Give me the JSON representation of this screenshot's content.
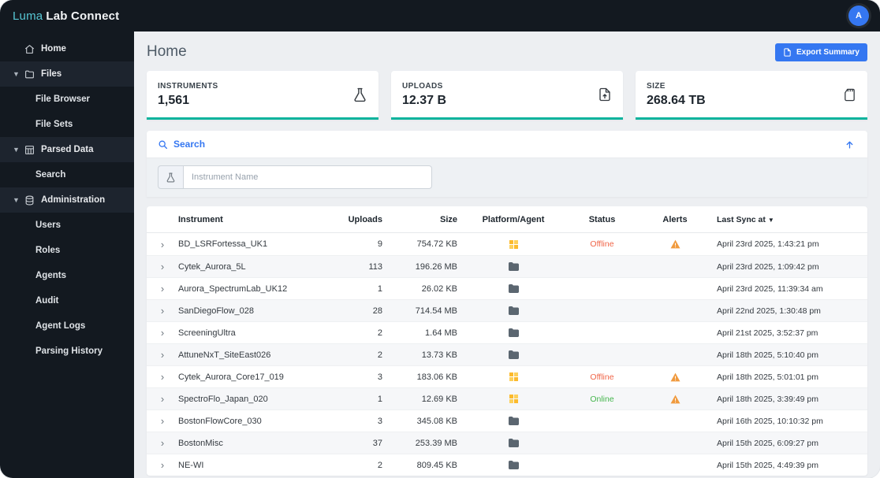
{
  "app": {
    "brand_luma": "Luma",
    "brand_rest": "Lab Connect",
    "avatar_initial": "A"
  },
  "sidebar": {
    "items": [
      {
        "label": "Home",
        "type": "link",
        "icon": "home-icon"
      },
      {
        "label": "Files",
        "type": "section",
        "icon": "folder-icon"
      },
      {
        "label": "File Browser",
        "type": "child"
      },
      {
        "label": "File Sets",
        "type": "child"
      },
      {
        "label": "Parsed Data",
        "type": "section",
        "icon": "table-icon"
      },
      {
        "label": "Search",
        "type": "child"
      },
      {
        "label": "Administration",
        "type": "section",
        "icon": "database-icon"
      },
      {
        "label": "Users",
        "type": "child"
      },
      {
        "label": "Roles",
        "type": "child"
      },
      {
        "label": "Agents",
        "type": "child"
      },
      {
        "label": "Audit",
        "type": "child"
      },
      {
        "label": "Agent Logs",
        "type": "child"
      },
      {
        "label": "Parsing History",
        "type": "child"
      }
    ]
  },
  "header": {
    "title": "Home",
    "export_button": "Export Summary"
  },
  "stats": [
    {
      "label": "INSTRUMENTS",
      "value": "1,561",
      "icon": "flask-icon"
    },
    {
      "label": "UPLOADS",
      "value": "12.37 B",
      "icon": "file-upload-icon"
    },
    {
      "label": "SIZE",
      "value": "268.64 TB",
      "icon": "storage-icon"
    }
  ],
  "search_panel": {
    "title": "Search",
    "input_placeholder": "Instrument Name"
  },
  "table": {
    "columns": [
      {
        "label": "Instrument"
      },
      {
        "label": "Uploads"
      },
      {
        "label": "Size"
      },
      {
        "label": "Platform/Agent"
      },
      {
        "label": "Status"
      },
      {
        "label": "Alerts"
      },
      {
        "label": "Last Sync at",
        "sort": "▼"
      }
    ],
    "rows": [
      {
        "instrument": "BD_LSRFortessa_UK1",
        "uploads": "9",
        "size": "754.72 KB",
        "platform": "grid",
        "status": "Offline",
        "alert": true,
        "last_sync": "April 23rd 2025, 1:43:21 pm"
      },
      {
        "instrument": "Cytek_Aurora_5L",
        "uploads": "113",
        "size": "196.26 MB",
        "platform": "folder",
        "status": "",
        "alert": false,
        "last_sync": "April 23rd 2025, 1:09:42 pm"
      },
      {
        "instrument": "Aurora_SpectrumLab_UK12",
        "uploads": "1",
        "size": "26.02 KB",
        "platform": "folder",
        "status": "",
        "alert": false,
        "last_sync": "April 23rd 2025, 11:39:34 am"
      },
      {
        "instrument": "SanDiegoFlow_028",
        "uploads": "28",
        "size": "714.54 MB",
        "platform": "folder",
        "status": "",
        "alert": false,
        "last_sync": "April 22nd 2025, 1:30:48 pm"
      },
      {
        "instrument": "ScreeningUltra",
        "uploads": "2",
        "size": "1.64 MB",
        "platform": "folder",
        "status": "",
        "alert": false,
        "last_sync": "April 21st 2025, 3:52:37 pm"
      },
      {
        "instrument": "AttuneNxT_SiteEast026",
        "uploads": "2",
        "size": "13.73 KB",
        "platform": "folder",
        "status": "",
        "alert": false,
        "last_sync": "April 18th 2025, 5:10:40 pm"
      },
      {
        "instrument": "Cytek_Aurora_Core17_019",
        "uploads": "3",
        "size": "183.06 KB",
        "platform": "grid",
        "status": "Offline",
        "alert": true,
        "last_sync": "April 18th 2025, 5:01:01 pm"
      },
      {
        "instrument": "SpectroFlo_Japan_020",
        "uploads": "1",
        "size": "12.69 KB",
        "platform": "grid",
        "status": "Online",
        "alert": true,
        "last_sync": "April 18th 2025, 3:39:49 pm"
      },
      {
        "instrument": "BostonFlowCore_030",
        "uploads": "3",
        "size": "345.08 KB",
        "platform": "folder",
        "status": "",
        "alert": false,
        "last_sync": "April 16th 2025, 10:10:32 pm"
      },
      {
        "instrument": "BostonMisc",
        "uploads": "37",
        "size": "253.39 MB",
        "platform": "folder",
        "status": "",
        "alert": false,
        "last_sync": "April 15th 2025, 6:09:27 pm"
      },
      {
        "instrument": "NE-WI",
        "uploads": "2",
        "size": "809.45 KB",
        "platform": "folder",
        "status": "",
        "alert": false,
        "last_sync": "April 15th 2025, 4:49:39 pm"
      }
    ]
  },
  "colors": {
    "accent_teal": "#0ab39c",
    "primary_blue": "#3577f1",
    "status_offline": "#f06548",
    "status_online": "#45b64d",
    "alert_warning": "#f09a3e",
    "platform_yellow": "#fcba2d",
    "sidebar_bg": "#131920"
  }
}
